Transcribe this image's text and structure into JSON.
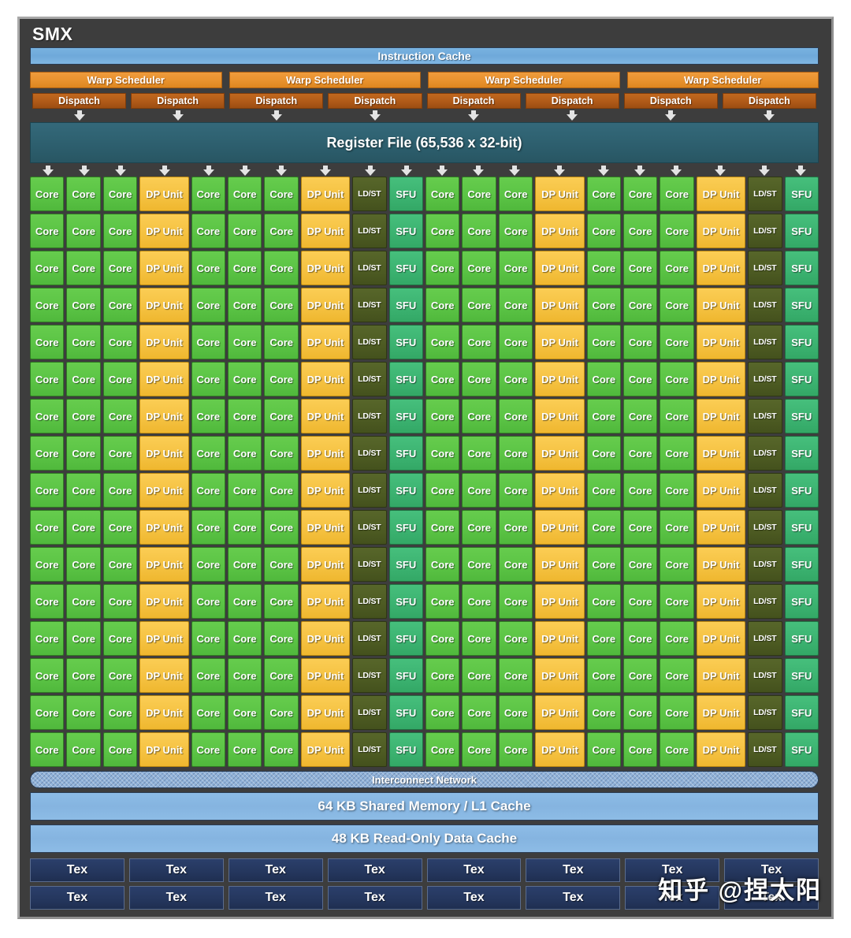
{
  "diagram": {
    "title": "SMX",
    "instruction_cache": "Instruction Cache",
    "register_file": "Register File (65,536 x 32-bit)",
    "interconnect": "Interconnect Network",
    "shared_memory": "64 KB Shared Memory / L1 Cache",
    "readonly_cache": "48 KB Read-Only Data Cache",
    "warp_schedulers": [
      "Warp Scheduler",
      "Warp Scheduler",
      "Warp Scheduler",
      "Warp Scheduler"
    ],
    "dispatch_units": [
      "Dispatch",
      "Dispatch",
      "Dispatch",
      "Dispatch",
      "Dispatch",
      "Dispatch",
      "Dispatch",
      "Dispatch"
    ],
    "unit_labels": {
      "core": "Core",
      "dp_unit": "DP Unit",
      "ld_st": "LD/ST",
      "sfu": "SFU",
      "tex": "Tex"
    },
    "core_grid": {
      "rows": 16,
      "columns": 20,
      "row_pattern": [
        "core",
        "core",
        "core",
        "dp",
        "core",
        "core",
        "core",
        "dp",
        "ldst",
        "sfu",
        "core",
        "core",
        "core",
        "dp",
        "core",
        "core",
        "core",
        "dp",
        "ldst",
        "sfu"
      ]
    },
    "tex_rows": [
      [
        "Tex",
        "Tex",
        "Tex",
        "Tex",
        "Tex",
        "Tex",
        "Tex",
        "Tex"
      ],
      [
        "Tex",
        "Tex",
        "Tex",
        "Tex",
        "Tex",
        "Tex",
        "Tex",
        "Tex"
      ]
    ],
    "watermark": "知乎 @捏太阳",
    "colors": {
      "panel": "#3d3d3d",
      "frame": "#a8a8a8",
      "instruction_cache": "#79b3e0",
      "warp_scheduler": "#e8922e",
      "dispatch": "#b05a18",
      "register_file": "#2d5f6e",
      "core": "#5bc445",
      "dp_unit": "#f5c242",
      "ld_st": "#4e5c23",
      "sfu": "#3cb371",
      "interconnect": "#8fb1d8",
      "cache": "#85b4e0",
      "tex": "#25375e"
    }
  }
}
